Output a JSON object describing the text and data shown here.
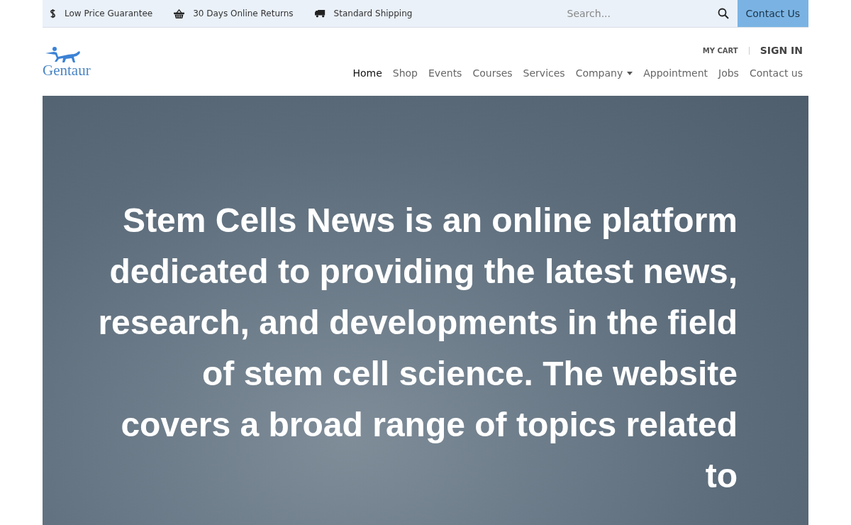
{
  "top_bar": {
    "features": [
      {
        "kind": "dollar",
        "label": "Low Price Guarantee"
      },
      {
        "kind": "basket",
        "label": "30 Days Online Returns"
      },
      {
        "kind": "truck",
        "label": "Standard Shipping"
      }
    ],
    "search": {
      "placeholder": "Search..."
    },
    "contact_button": "Contact Us"
  },
  "header": {
    "logo": "Gentaur",
    "cart": "MY CART",
    "sign_in": "SIGN IN",
    "nav": [
      {
        "label": "Home",
        "selected": true,
        "dropdown": false
      },
      {
        "label": "Shop",
        "selected": false,
        "dropdown": false
      },
      {
        "label": "Events",
        "selected": false,
        "dropdown": false
      },
      {
        "label": "Courses",
        "selected": false,
        "dropdown": false
      },
      {
        "label": "Services",
        "selected": false,
        "dropdown": false
      },
      {
        "label": "Company",
        "selected": false,
        "dropdown": true
      },
      {
        "label": "Appointment",
        "selected": false,
        "dropdown": false
      },
      {
        "label": "Jobs",
        "selected": false,
        "dropdown": false
      },
      {
        "label": "Contact us",
        "selected": false,
        "dropdown": false
      }
    ]
  },
  "hero": {
    "text": "Stem Cells News is an online platform dedicated to providing the latest news, research, and developments in the field of stem cell science. The website covers a broad range of topics related to"
  }
}
